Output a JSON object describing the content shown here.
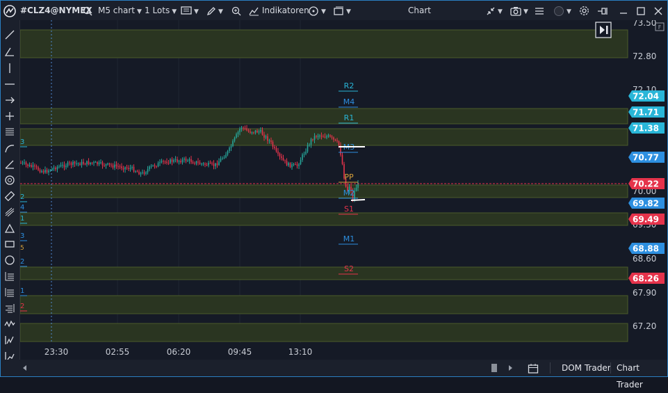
{
  "toolbar": {
    "symbol": "#CLZ4@NYMEX",
    "timeframe": "M5 chart",
    "lots": "1 Lots",
    "indicators": "Indikatoren",
    "window_title": "Chart"
  },
  "chart": {
    "price_axis_labels": [
      "73.50",
      "72.80",
      "72.10",
      "70.00",
      "69.30",
      "68.60",
      "67.90",
      "67.20"
    ],
    "badges": [
      {
        "value": "72.04",
        "color": "#29b6d8"
      },
      {
        "value": "71.71",
        "color": "#29b6d8"
      },
      {
        "value": "71.38",
        "color": "#29b6d8"
      },
      {
        "value": "70.77",
        "color": "#2d8fe0"
      },
      {
        "value": "70.22",
        "color": "#e5334b"
      },
      {
        "value": "69.82",
        "color": "#2d8fe0"
      },
      {
        "value": "69.49",
        "color": "#e5334b"
      },
      {
        "value": "68.88",
        "color": "#2d8fe0"
      },
      {
        "value": "68.26",
        "color": "#e5334b"
      }
    ],
    "time_labels": [
      "23:30",
      "02:55",
      "06:20",
      "09:45",
      "13:10"
    ],
    "pivot_labels": [
      {
        "text": "R2",
        "color": "#29b6d8"
      },
      {
        "text": "M4",
        "color": "#2d8fe0"
      },
      {
        "text": "R1",
        "color": "#29b6d8"
      },
      {
        "text": "M3",
        "color": "#2d8fe0"
      },
      {
        "text": "PP",
        "color": "#d9a23a"
      },
      {
        "text": "M2",
        "color": "#2d8fe0"
      },
      {
        "text": "S1",
        "color": "#e5334b"
      },
      {
        "text": "M1",
        "color": "#2d8fe0"
      },
      {
        "text": "S2",
        "color": "#e5334b"
      }
    ],
    "left_edge_digits": [
      {
        "text": "3",
        "color": "#29b6d8"
      },
      {
        "text": "2",
        "color": "#29b6d8"
      },
      {
        "text": "4",
        "color": "#2d8fe0"
      },
      {
        "text": "1",
        "color": "#29b6d8"
      },
      {
        "text": "3",
        "color": "#2d8fe0"
      },
      {
        "text": "2",
        "color": "#2d8fe0"
      },
      {
        "text": "1",
        "color": "#2d8fe0"
      },
      {
        "text": "2",
        "color": "#e5334b"
      }
    ]
  },
  "bottombar": {
    "dom_trader": "DOM Trader",
    "chart_trader": "Chart Trader"
  }
}
